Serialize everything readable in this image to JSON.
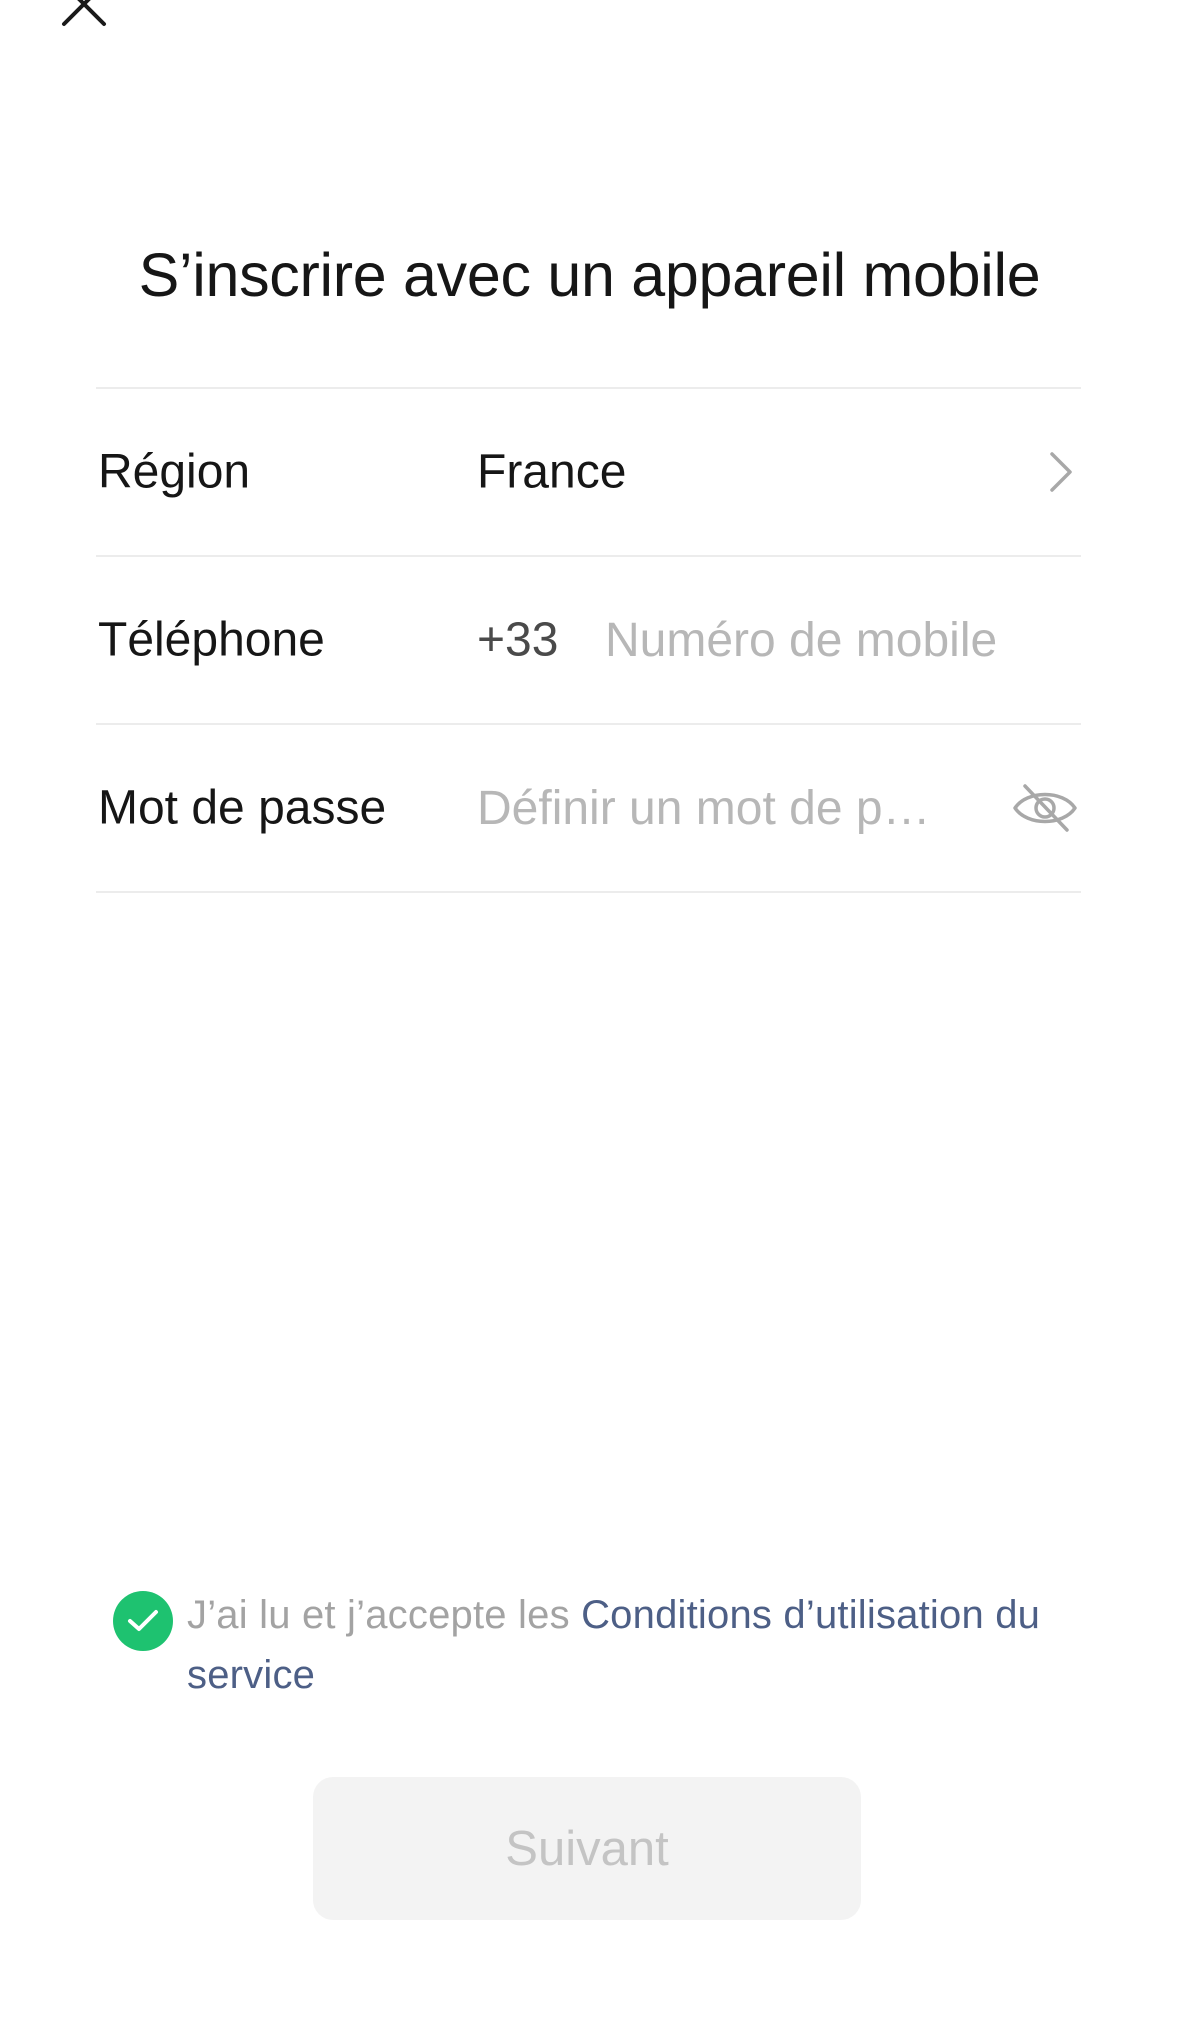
{
  "header": {
    "close_icon": "close-icon",
    "title": "S’inscrire avec un appareil mobile"
  },
  "form": {
    "region": {
      "label": "Région",
      "value": "France",
      "icon": "chevron-right-icon"
    },
    "phone": {
      "label": "Téléphone",
      "country_code": "+33",
      "value": "",
      "placeholder": "Numéro de mobile"
    },
    "password": {
      "label": "Mot de passe",
      "value": "",
      "placeholder": "Définir un mot de passe",
      "visibility_icon": "eye-off-icon"
    }
  },
  "agreement": {
    "checked": true,
    "text": "J’ai lu et j’accepte les ",
    "link_text": "Conditions d’utilisation du service"
  },
  "actions": {
    "next_label": "Suivant",
    "next_enabled": false
  },
  "colors": {
    "check_green": "#1ec270",
    "link_blue": "#4d5f86",
    "placeholder_gray": "#b7b7b7",
    "button_disabled_bg": "#f3f3f3",
    "button_disabled_text": "#c4c4c4"
  }
}
